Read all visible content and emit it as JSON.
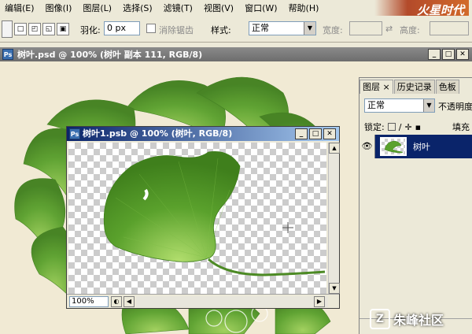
{
  "menu": [
    "编辑(E)",
    "图像(I)",
    "图层(L)",
    "选择(S)",
    "滤镜(T)",
    "视图(V)",
    "窗口(W)",
    "帮助(H)"
  ],
  "brand": "火星时代",
  "options": {
    "feather_label": "羽化:",
    "feather_value": "0 px",
    "antialias_label": "消除锯齿",
    "style_label": "样式:",
    "style_value": "正常",
    "width_label": "宽度:",
    "height_label": "高度:",
    "swap_icon": "swap-arrows-icon"
  },
  "doc1": {
    "title": "树叶.psd @ 100% (树叶 副本 111, RGB/8)",
    "app_icon": "Ps"
  },
  "doc2": {
    "title": "树叶1.psb @ 100% (树叶, RGB/8)",
    "app_icon": "Ps",
    "zoom": "100%"
  },
  "layers_panel": {
    "tabs": [
      "图层",
      "历史记录",
      "色板"
    ],
    "blend_mode": "正常",
    "opacity_label": "不透明度",
    "lock_label": "锁定:",
    "fill_label": "填充",
    "layer_name": "树叶",
    "tab_close": "×"
  },
  "watermark": {
    "logo": "Z",
    "text": "朱峰社区"
  },
  "colors": {
    "leaf": "#5aa12c",
    "leaf_dark": "#3f7f1c",
    "title_active": "#0a246a",
    "selected_layer": "#0a246a"
  }
}
